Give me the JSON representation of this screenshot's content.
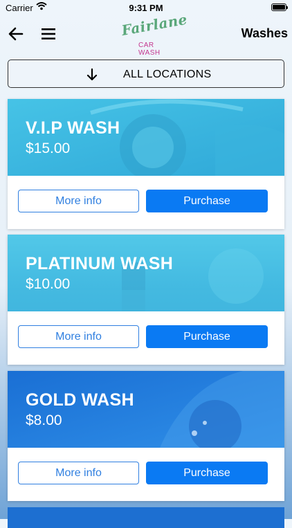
{
  "status_bar": {
    "carrier": "Carrier",
    "time": "9:31 PM"
  },
  "nav": {
    "title": "Washes",
    "logo": {
      "brand": "Fairlane",
      "sub": "CAR WASH"
    }
  },
  "location": {
    "label": "ALL LOCATIONS"
  },
  "cards": [
    {
      "name": "V.I.P WASH",
      "price": "$15.00",
      "more_label": "More info",
      "purchase_label": "Purchase"
    },
    {
      "name": "PLATINUM WASH",
      "price": "$10.00",
      "more_label": "More info",
      "purchase_label": "Purchase"
    },
    {
      "name": "GOLD WASH",
      "price": "$8.00",
      "more_label": "More info",
      "purchase_label": "Purchase"
    }
  ],
  "colors": {
    "accent": "#0a7af3",
    "outline": "#2f7fe0",
    "brand_green": "#5aa77a",
    "brand_pink": "#c4368e"
  }
}
